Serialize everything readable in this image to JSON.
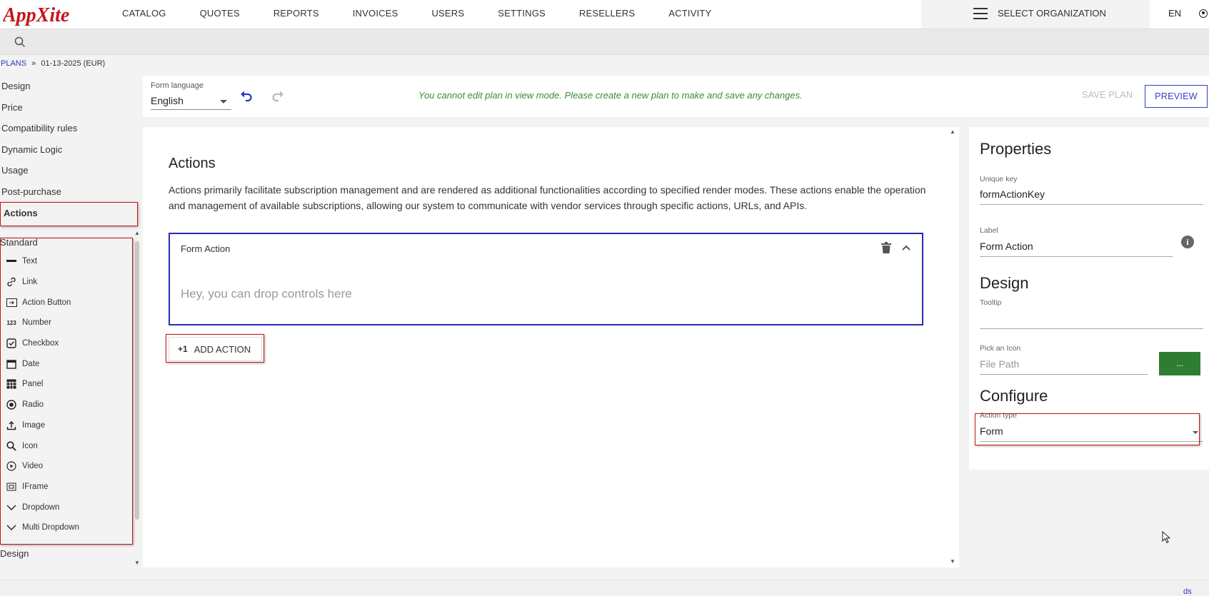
{
  "app": {
    "logo_text": "AppXite"
  },
  "nav": [
    "CATALOG",
    "QUOTES",
    "REPORTS",
    "INVOICES",
    "USERS",
    "SETTINGS",
    "RESELLERS",
    "ACTIVITY"
  ],
  "header": {
    "org_label": "SELECT ORGANIZATION",
    "language": "EN"
  },
  "breadcrumb": {
    "root": "PLANS",
    "separator": "»",
    "current": "01-13-2025 (EUR)"
  },
  "left_nav": {
    "items": [
      "Design",
      "Price",
      "Compatibility rules",
      "Dynamic Logic",
      "Usage",
      "Post-purchase"
    ],
    "active": "Actions"
  },
  "palette": {
    "heading": "Standard",
    "controls": [
      {
        "label": "Text",
        "icon": "text-icon"
      },
      {
        "label": "Link",
        "icon": "link-icon"
      },
      {
        "label": "Action Button",
        "icon": "action-button-icon"
      },
      {
        "label": "Number",
        "icon": "number-icon",
        "glyph": "123"
      },
      {
        "label": "Checkbox",
        "icon": "checkbox-icon"
      },
      {
        "label": "Date",
        "icon": "calendar-icon"
      },
      {
        "label": "Panel",
        "icon": "table-icon"
      },
      {
        "label": "Radio",
        "icon": "radio-icon"
      },
      {
        "label": "Image",
        "icon": "upload-icon"
      },
      {
        "label": "Icon",
        "icon": "magnifier-icon"
      },
      {
        "label": "Video",
        "icon": "play-icon"
      },
      {
        "label": "IFrame",
        "icon": "iframe-icon"
      },
      {
        "label": "Dropdown",
        "icon": "chevron-down-icon"
      },
      {
        "label": "Multi Dropdown",
        "icon": "chevron-down-icon"
      }
    ],
    "next_heading": "Design"
  },
  "toolbar": {
    "form_language_label": "Form language",
    "form_language_value": "English",
    "readonly_message": "You cannot edit plan in view mode. Please create a new plan to make and save any changes.",
    "save_label": "SAVE PLAN",
    "preview_label": "PREVIEW"
  },
  "main": {
    "title": "Actions",
    "description": "Actions primarily facilitate subscription management and are rendered as additional functionalities according to specified render modes. These actions enable the operation and management of available subscriptions, allowing our system to communicate with vendor services through specific actions, URLs, and APIs.",
    "action_box_title": "Form Action",
    "drop_hint": "Hey, you can drop controls here",
    "add_action_prefix": "+1",
    "add_action_label": "ADD ACTION"
  },
  "properties": {
    "title": "Properties",
    "unique_key_label": "Unique key",
    "unique_key_value": "formActionKey",
    "label_label": "Label",
    "label_value": "Form Action",
    "design_title": "Design",
    "tooltip_label": "Tooltip",
    "tooltip_value": "",
    "icon_label": "Pick an Icon",
    "icon_placeholder": "File Path",
    "browse_label": "...",
    "configure_title": "Configure",
    "action_type_label": "Action type",
    "action_type_value": "Form"
  },
  "footer": {
    "link": "ds"
  },
  "colors": {
    "brand_red": "#c4161c",
    "accent_blue": "#3140c8",
    "success_green": "#2e7d32",
    "readonly_green": "#3a8a3a"
  }
}
